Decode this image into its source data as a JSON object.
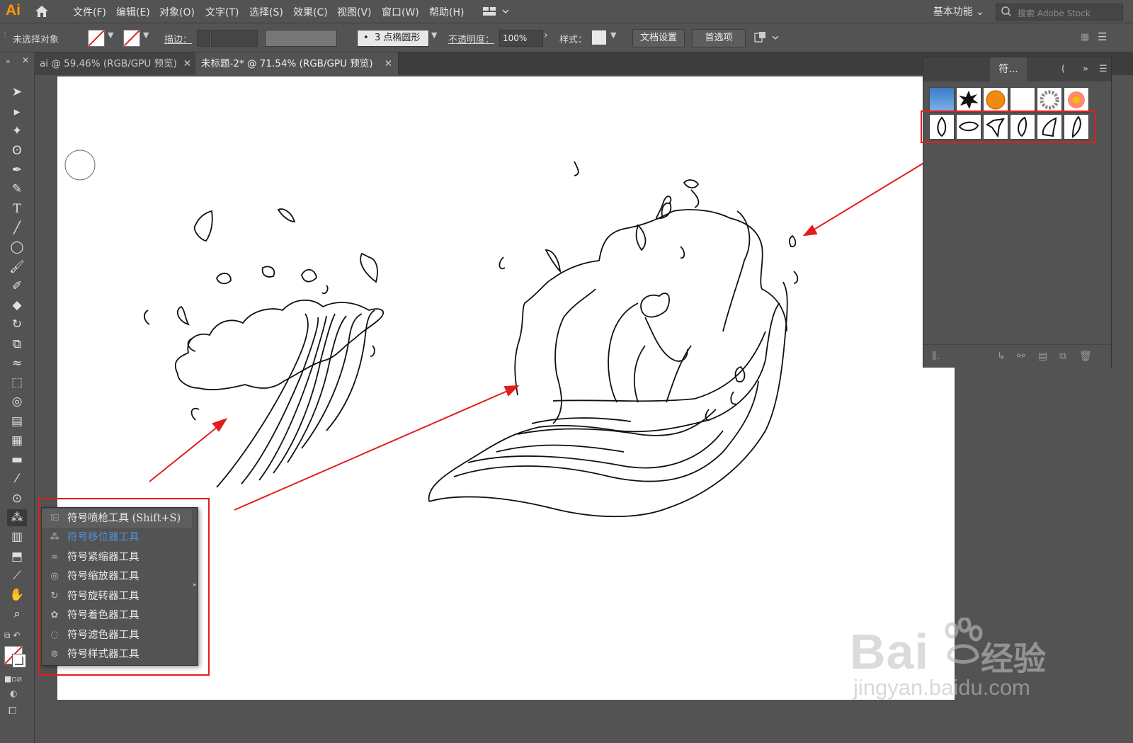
{
  "app": {
    "logo": "Ai"
  },
  "menu": [
    "文件(F)",
    "编辑(E)",
    "对象(O)",
    "文字(T)",
    "选择(S)",
    "效果(C)",
    "视图(V)",
    "窗口(W)",
    "帮助(H)"
  ],
  "workspace": "基本功能",
  "search_placeholder": "搜索 Adobe Stock",
  "control": {
    "selection": "未选择对象",
    "stroke_label": "描边：",
    "brush": "3 点椭圆形",
    "opacity_label": "不透明度：",
    "opacity_value": "100%",
    "style_label": "样式：",
    "doc_setup": "文档设置",
    "prefs": "首选项"
  },
  "tabs": [
    {
      "label": "ai @ 59.46% (RGB/GPU 预览)",
      "active": false
    },
    {
      "label": "未标题-2* @ 71.54% (RGB/GPU 预览)",
      "active": true
    }
  ],
  "flyout": {
    "items": [
      {
        "label": "符号喷枪工具  (Shift+S)",
        "icon": "symbol-sprayer-icon"
      },
      {
        "label": "符号移位器工具",
        "icon": "symbol-shifter-icon",
        "highlight": true
      },
      {
        "label": "符号紧缩器工具",
        "icon": "symbol-scruncher-icon"
      },
      {
        "label": "符号缩放器工具",
        "icon": "symbol-sizer-icon"
      },
      {
        "label": "符号旋转器工具",
        "icon": "symbol-spinner-icon"
      },
      {
        "label": "符号着色器工具",
        "icon": "symbol-stainer-icon"
      },
      {
        "label": "符号滤色器工具",
        "icon": "symbol-screener-icon"
      },
      {
        "label": "符号样式器工具",
        "icon": "symbol-styler-icon"
      }
    ]
  },
  "symbols_panel": {
    "tab": "符..."
  },
  "watermark": {
    "brand": "Bai",
    "cn": "经验",
    "url": "jingyan.baidu.com"
  },
  "colors": {
    "accent_red": "#e21d1d",
    "highlight_blue": "#4d8fdd",
    "logo_orange": "#ff9a00"
  }
}
